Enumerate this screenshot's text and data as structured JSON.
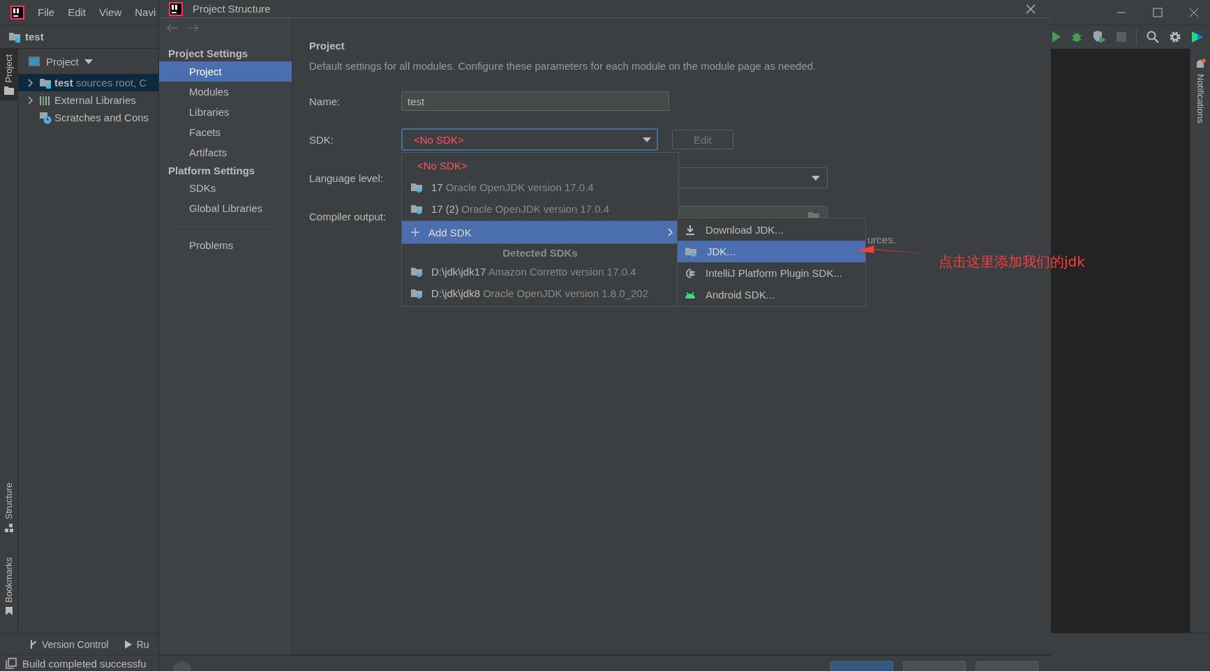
{
  "ide": {
    "menu": [
      "File",
      "Edit",
      "View",
      "Navi"
    ],
    "project_name": "test",
    "tool_stripe_top": [
      {
        "kind": "project",
        "label": "Project",
        "selected": true
      }
    ],
    "tool_stripe_bottom": [
      {
        "kind": "structure",
        "label": "Structure",
        "selected": false
      },
      {
        "kind": "bookmarks",
        "label": "Bookmarks",
        "selected": false
      }
    ],
    "project_view": {
      "title": "Project",
      "tree": [
        {
          "kind": "module",
          "name": "test",
          "detail": "sources root, C",
          "expanded": false,
          "selected": true
        },
        {
          "kind": "libraries",
          "name": "External Libraries",
          "expanded": false,
          "selected": false
        },
        {
          "kind": "scratches",
          "name": "Scratches and Cons",
          "selected": false
        }
      ]
    },
    "bottom_tabs": [
      {
        "kind": "vcs",
        "label": "Version Control"
      },
      {
        "kind": "run",
        "label": "Ru"
      }
    ],
    "status": "Build completed successfu",
    "right_stripe": [
      {
        "label": "Notifications",
        "badge": true
      }
    ]
  },
  "dialog": {
    "title": "Project Structure",
    "sidebar": [
      {
        "heading": "Project Settings",
        "items": [
          {
            "label": "Project",
            "selected": true
          },
          {
            "label": "Modules",
            "selected": false
          },
          {
            "label": "Libraries",
            "selected": false
          },
          {
            "label": "Facets",
            "selected": false
          },
          {
            "label": "Artifacts",
            "selected": false
          }
        ]
      },
      {
        "heading": "Platform Settings",
        "items": [
          {
            "label": "SDKs",
            "selected": false
          },
          {
            "label": "Global Libraries",
            "selected": false
          }
        ]
      },
      {
        "items": [
          {
            "label": "Problems",
            "selected": false
          }
        ]
      }
    ],
    "page": {
      "title": "Project",
      "description": "Default settings for all modules. Configure these parameters for each module on the module page as needed.",
      "fields": [
        {
          "kind": "text",
          "label": "Name:",
          "value": "test"
        },
        {
          "kind": "sdk",
          "label": "SDK:",
          "value": "<No SDK>",
          "invalid": true,
          "button": {
            "label": "Edit",
            "disabled": true
          }
        },
        {
          "kind": "combo",
          "label": "Language level:"
        },
        {
          "kind": "path",
          "label": "Compiler output:"
        }
      ],
      "hint": "urces."
    },
    "sdk_popup": [
      {
        "kind": "none",
        "label": "<No SDK>",
        "selected": false
      },
      {
        "kind": "sdk",
        "name": "17",
        "detail": "Oracle OpenJDK version 17.0.4",
        "selected": false
      },
      {
        "kind": "sdk",
        "name": "17 (2)",
        "detail": "Oracle OpenJDK version 17.0.4",
        "selected": false
      },
      {
        "kind": "action",
        "label": "Add SDK",
        "selected": true
      },
      {
        "kind": "header",
        "label": "Detected SDKs"
      },
      {
        "kind": "sdk",
        "name": "D:\\jdk\\jdk17",
        "detail": "Amazon Corretto version 17.0.4",
        "selected": false
      },
      {
        "kind": "sdk",
        "name": "D:\\jdk\\jdk8",
        "detail": "Oracle OpenJDK version 1.8.0_202",
        "selected": false
      }
    ],
    "add_sdk_submenu": [
      {
        "kind": "download",
        "label": "Download JDK...",
        "selected": false
      },
      {
        "kind": "jdk",
        "label": "JDK...",
        "selected": true
      },
      {
        "kind": "plugin",
        "label": "IntelliJ Platform Plugin SDK...",
        "selected": false
      },
      {
        "kind": "android",
        "label": "Android SDK...",
        "selected": false
      }
    ]
  },
  "annotation": {
    "text": "点击这里添加我们的jdk"
  }
}
